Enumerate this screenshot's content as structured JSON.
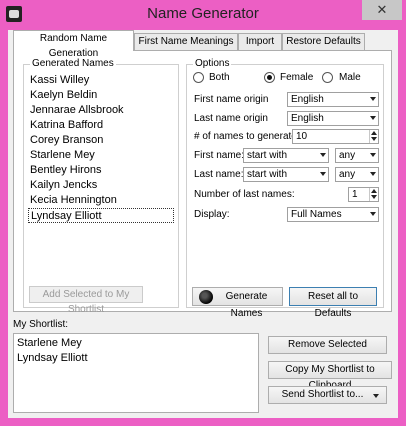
{
  "window": {
    "title": "Name Generator",
    "close_glyph": "✕"
  },
  "tabs": [
    {
      "label": "Random Name Generation",
      "active": true
    },
    {
      "label": "First Name Meanings"
    },
    {
      "label": "Import"
    },
    {
      "label": "Restore Defaults"
    }
  ],
  "generated": {
    "label": "Generated Names",
    "names": [
      "Kassi Willey",
      "Kaelyn Beldin",
      "Jennarae Allsbrook",
      "Katrina Bafford",
      "Corey Branson",
      "Starlene Mey",
      "Bentley Hirons",
      "Kailyn Jencks",
      "Kecia Hennington",
      "Lyndsay Elliott"
    ],
    "selected_index": 9,
    "add_button": "Add Selected to My Shortlist"
  },
  "options": {
    "label": "Options",
    "gender": {
      "both": "Both",
      "female": "Female",
      "male": "Male",
      "selected": "female"
    },
    "first_origin": {
      "label": "First name origin",
      "value": "English"
    },
    "last_origin": {
      "label": "Last name origin",
      "value": "English"
    },
    "count": {
      "label": "# of names to generate:",
      "value": "10"
    },
    "first_name": {
      "label": "First name:",
      "mode": "start with",
      "letter": "any"
    },
    "last_name": {
      "label": "Last name:",
      "mode": "start with",
      "letter": "any"
    },
    "last_count": {
      "label": "Number of last names:",
      "value": "1"
    },
    "display": {
      "label": "Display:",
      "value": "Full Names"
    },
    "generate_button": "Generate Names",
    "reset_button": "Reset all to Defaults"
  },
  "shortlist": {
    "label": "My Shortlist:",
    "names": [
      "Starlene Mey",
      "Lyndsay Elliott"
    ],
    "remove_button": "Remove Selected",
    "copy_button": "Copy My Shortlist to Clipboard",
    "send_button": "Send Shortlist to..."
  }
}
